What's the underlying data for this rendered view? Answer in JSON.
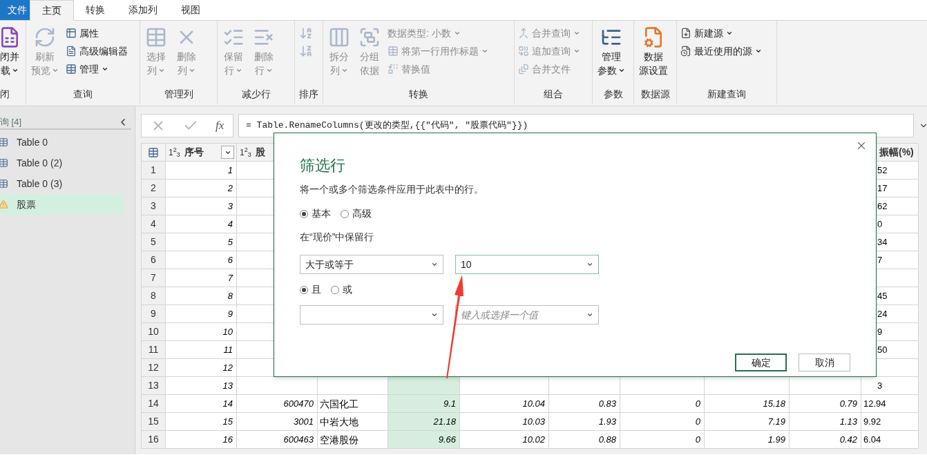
{
  "tabs": [
    {
      "label": "文件",
      "kind": "file",
      "selected": false
    },
    {
      "label": "主页",
      "kind": "tab",
      "selected": true
    },
    {
      "label": "转换",
      "kind": "tab",
      "selected": false
    },
    {
      "label": "添加列",
      "kind": "tab",
      "selected": false
    },
    {
      "label": "视图",
      "kind": "tab",
      "selected": false
    }
  ],
  "ribbon": [
    {
      "label": "闭",
      "items": [
        {
          "kind": "large",
          "lines": [
            "闭并",
            "载"
          ],
          "dropdown": true,
          "disabled": false
        }
      ]
    },
    {
      "label": "查询",
      "items": [
        {
          "kind": "large",
          "lines": [
            "刷新",
            "预览"
          ],
          "dropdown": true,
          "disabled": true
        },
        {
          "kind": "small",
          "label": "属性",
          "dropdown": false,
          "disabled": false
        },
        {
          "kind": "small",
          "label": "高级编辑器",
          "dropdown": false,
          "disabled": false
        },
        {
          "kind": "small",
          "label": "管理",
          "dropdown": true,
          "disabled": false
        }
      ]
    },
    {
      "label": "管理列",
      "items": [
        {
          "kind": "large",
          "lines": [
            "选择",
            "列"
          ],
          "dropdown": true,
          "disabled": true
        },
        {
          "kind": "large",
          "lines": [
            "删除",
            "列"
          ],
          "dropdown": true,
          "disabled": true
        }
      ]
    },
    {
      "label": "减少行",
      "items": [
        {
          "kind": "large",
          "lines": [
            "保留",
            "行"
          ],
          "dropdown": true,
          "disabled": true
        },
        {
          "kind": "large",
          "lines": [
            "删除",
            "行"
          ],
          "dropdown": true,
          "disabled": true
        }
      ]
    },
    {
      "label": "排序",
      "items": [
        {
          "kind": "icon",
          "disabled": true
        },
        {
          "kind": "icon",
          "disabled": true
        }
      ]
    },
    {
      "label": "转换",
      "items": [
        {
          "kind": "large",
          "lines": [
            "拆分",
            "列"
          ],
          "dropdown": true,
          "disabled": true
        },
        {
          "kind": "large",
          "lines": [
            "分组",
            "依据"
          ],
          "dropdown": false,
          "disabled": true
        },
        {
          "kind": "small",
          "label": "数据类型: 小数",
          "dropdown": true,
          "disabled": true
        },
        {
          "kind": "small",
          "label": "将第一行用作标题",
          "dropdown": true,
          "disabled": true
        },
        {
          "kind": "small",
          "label": "替换值",
          "dropdown": false,
          "disabled": true
        }
      ]
    },
    {
      "label": "组合",
      "items": [
        {
          "kind": "small",
          "label": "合并查询",
          "dropdown": true,
          "disabled": true
        },
        {
          "kind": "small",
          "label": "追加查询",
          "dropdown": true,
          "disabled": true
        },
        {
          "kind": "small",
          "label": "合并文件",
          "dropdown": false,
          "disabled": true
        }
      ]
    },
    {
      "label": "参数",
      "items": [
        {
          "kind": "large",
          "lines": [
            "管理",
            "参数"
          ],
          "dropdown": true,
          "disabled": false
        }
      ]
    },
    {
      "label": "数据源",
      "items": [
        {
          "kind": "large",
          "lines": [
            "数据",
            "源设置"
          ],
          "dropdown": false,
          "disabled": false
        }
      ]
    },
    {
      "label": "新建查询",
      "items": [
        {
          "kind": "small",
          "label": "新建源",
          "dropdown": true,
          "disabled": false
        },
        {
          "kind": "small",
          "label": "最近使用的源",
          "dropdown": true,
          "disabled": false
        }
      ]
    }
  ],
  "queries": {
    "header": "询 [4]",
    "items": [
      {
        "label": "Table 0",
        "kind": "table",
        "selected": false
      },
      {
        "label": "Table 0 (2)",
        "kind": "table",
        "selected": false
      },
      {
        "label": "Table 0 (3)",
        "kind": "table",
        "selected": false
      },
      {
        "label": "股票",
        "kind": "warning",
        "selected": true
      }
    ]
  },
  "formula": {
    "fx": "fx",
    "text": "= Table.RenameColumns(更改的类型,{{\"代码\", \"股票代码\"}})"
  },
  "table": {
    "columns": [
      {
        "type": "1$^{2}$$_{3}$",
        "label": "序号",
        "filter": true
      },
      {
        "type": "1$^{2}$$_{3}$",
        "label": "股"
      },
      {
        "label": "振幅(%)"
      }
    ],
    "rows": [
      {
        "number": "1",
        "seq": "1",
        "fragment": "52"
      },
      {
        "number": "2",
        "seq": "2",
        "fragment": "17"
      },
      {
        "number": "3",
        "seq": "3",
        "fragment": "62"
      },
      {
        "number": "4",
        "seq": "4",
        "fragment": "0"
      },
      {
        "number": "5",
        "seq": "5",
        "fragment": "34"
      },
      {
        "number": "6",
        "seq": "6",
        "fragment": "7"
      },
      {
        "number": "7",
        "seq": "7"
      },
      {
        "number": "8",
        "seq": "8",
        "fragment": "45"
      },
      {
        "number": "9",
        "seq": "9",
        "fragment": "24"
      },
      {
        "number": "10",
        "seq": "10",
        "fragment": "9"
      },
      {
        "number": "11",
        "seq": "11",
        "fragment": "50"
      },
      {
        "number": "12",
        "seq": "12"
      },
      {
        "number": "13",
        "seq": "13",
        "fragment": "3"
      },
      {
        "number": "14",
        "seq": "14",
        "code": "600470",
        "name": "六国化工",
        "values": [
          "9.1",
          "10.04",
          "0.83",
          "0",
          "15.18",
          "0.79"
        ],
        "amplitude": "12.94"
      },
      {
        "number": "15",
        "seq": "15",
        "code": "3001",
        "name": "中岩大地",
        "values": [
          "21.18",
          "10.03",
          "1.93",
          "0",
          "7.19",
          "1.13"
        ],
        "amplitude": "9.92"
      },
      {
        "number": "16",
        "seq": "16",
        "code": "600463",
        "name": "空港股份",
        "values": [
          "9.66",
          "10.02",
          "0.88",
          "0",
          "1.99",
          "0.42"
        ],
        "amplitude": "6.04"
      }
    ]
  },
  "dialog": {
    "title": "筛选行",
    "description": "将一个或多个筛选条件应用于此表中的行。",
    "modes": [
      {
        "label": "基本",
        "selected": true
      },
      {
        "label": "高级",
        "selected": false
      }
    ],
    "keep_label": "在“现价”中保留行",
    "condition1": {
      "operator": "大于或等于",
      "value": "10"
    },
    "joins": [
      {
        "label": "且",
        "selected": true
      },
      {
        "label": "或",
        "selected": false
      }
    ],
    "condition2": {
      "placeholder": "键入或选择一个值"
    },
    "buttons": [
      {
        "label": "确定",
        "kind": "primary"
      },
      {
        "label": "取消",
        "kind": "secondary"
      }
    ]
  }
}
